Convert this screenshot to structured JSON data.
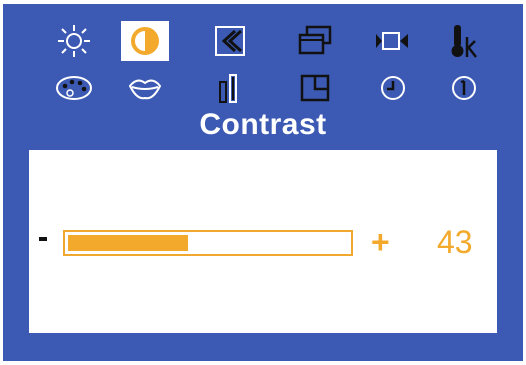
{
  "osd": {
    "colors": {
      "background": "#3c5ab4",
      "accent": "#f3aa2c",
      "panel": "#ffffff",
      "icon": "#ffffff",
      "icon_stroke": "#111111"
    },
    "icons_row1": [
      {
        "name": "brightness-icon",
        "selected": false
      },
      {
        "name": "contrast-icon",
        "selected": true
      },
      {
        "name": "position-icon",
        "selected": false
      },
      {
        "name": "size-icon",
        "selected": false
      },
      {
        "name": "video-input-icon",
        "selected": false
      },
      {
        "name": "color-temperature-icon",
        "selected": false
      }
    ],
    "icons_row2": [
      {
        "name": "color-palette-icon",
        "selected": false
      },
      {
        "name": "lips-icon",
        "selected": false
      },
      {
        "name": "bars-icon",
        "selected": false
      },
      {
        "name": "window-icon",
        "selected": false
      },
      {
        "name": "clock-icon",
        "selected": false
      },
      {
        "name": "info-icon",
        "selected": false
      }
    ],
    "title": "Contrast",
    "slider": {
      "minus_label": "-",
      "plus_label": "+",
      "value": "43",
      "level_fraction": 0.43
    }
  }
}
